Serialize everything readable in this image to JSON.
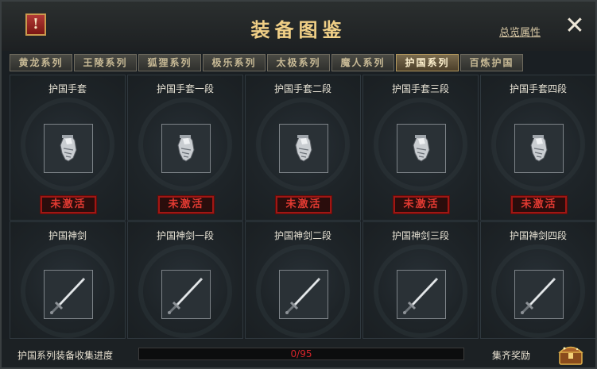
{
  "window": {
    "title": "装备图鉴",
    "overview_link": "总览属性",
    "alert_glyph": "!",
    "close_glyph": "✕"
  },
  "tabs": [
    {
      "label": "黄龙系列",
      "active": false
    },
    {
      "label": "王陵系列",
      "active": false
    },
    {
      "label": "狐狸系列",
      "active": false
    },
    {
      "label": "极乐系列",
      "active": false
    },
    {
      "label": "太极系列",
      "active": false
    },
    {
      "label": "魔人系列",
      "active": false
    },
    {
      "label": "护国系列",
      "active": true
    },
    {
      "label": "百炼护国",
      "active": false
    }
  ],
  "items": [
    {
      "name": "护国手套",
      "icon": "gauntlet-icon",
      "status": "未激活"
    },
    {
      "name": "护国手套一段",
      "icon": "gauntlet-icon",
      "status": "未激活"
    },
    {
      "name": "护国手套二段",
      "icon": "gauntlet-icon",
      "status": "未激活"
    },
    {
      "name": "护国手套三段",
      "icon": "gauntlet-icon",
      "status": "未激活"
    },
    {
      "name": "护国手套四段",
      "icon": "gauntlet-icon",
      "status": "未激活"
    },
    {
      "name": "护国神剑",
      "icon": "sword-icon"
    },
    {
      "name": "护国神剑一段",
      "icon": "sword-icon"
    },
    {
      "name": "护国神剑二段",
      "icon": "sword-icon"
    },
    {
      "name": "护国神剑三段",
      "icon": "sword-icon"
    },
    {
      "name": "护国神剑四段",
      "icon": "sword-icon"
    }
  ],
  "footer": {
    "progress_label": "护国系列装备收集进度",
    "progress_text": "0/95",
    "progress_current": 0,
    "progress_total": 95,
    "reward_label": "集齐奖励",
    "reward_icon": "treasure-chest-icon"
  },
  "colors": {
    "title_gold": "#f0cf86",
    "inactive_red": "#e23a32",
    "progress_text_red": "#d6252b"
  }
}
